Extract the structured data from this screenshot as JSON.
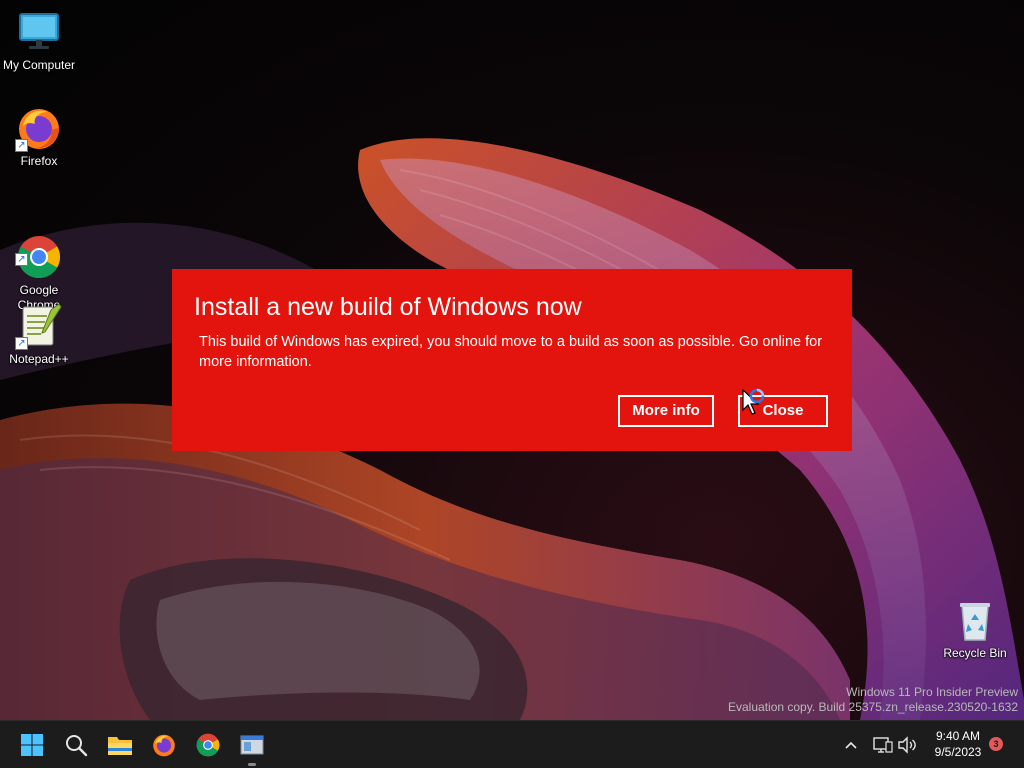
{
  "desktop": {
    "icons": [
      {
        "label": "My Computer",
        "icon": "monitor-icon"
      },
      {
        "label": "Firefox",
        "icon": "firefox-icon"
      },
      {
        "label": "Google\nChrome",
        "icon": "chrome-icon"
      },
      {
        "label": "Notepad++",
        "icon": "notepad-plus-plus-icon"
      },
      {
        "label": "Recycle Bin",
        "icon": "recycle-bin-icon"
      }
    ]
  },
  "dialog": {
    "title": "Install a new build of Windows now",
    "message": "This build of Windows has expired, you should move to a build as soon as possible. Go online for more information.",
    "more_info_label": "More info",
    "close_label": "Close",
    "background_color": "#e2140d"
  },
  "watermark": {
    "line1": "Windows 11 Pro Insider Preview",
    "line2": "Evaluation copy. Build 25375.zn_release.230520-1632"
  },
  "taskbar": {
    "pinned": [
      "start-icon",
      "search-icon",
      "file-explorer-icon",
      "firefox-icon",
      "chrome-icon",
      "app-window-icon"
    ],
    "clock": {
      "time": "9:40 AM",
      "date": "9/5/2023"
    },
    "notification_count": "3"
  }
}
